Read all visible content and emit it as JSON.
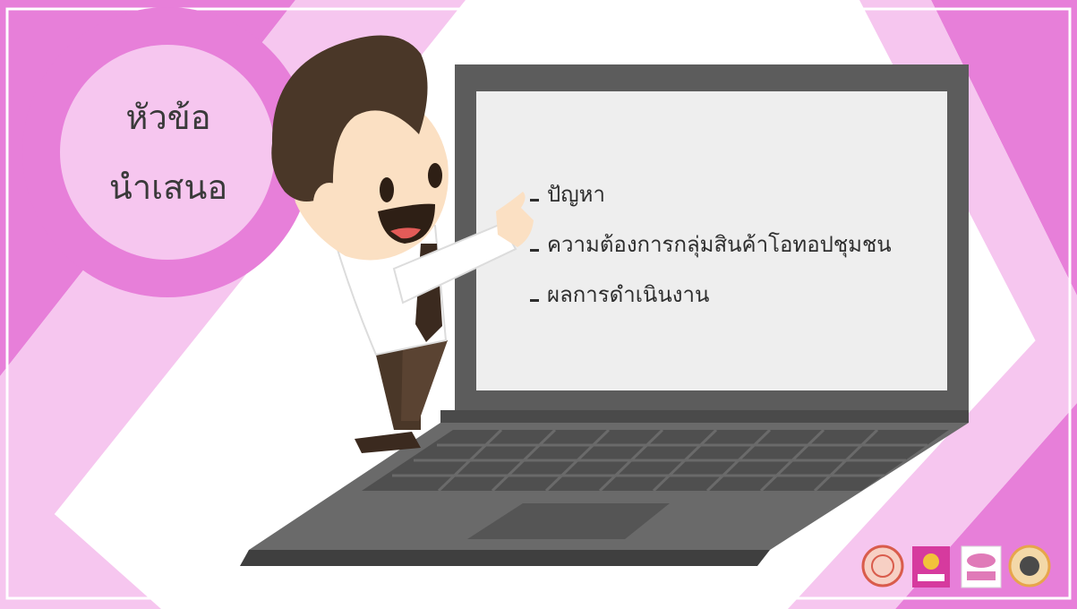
{
  "slide": {
    "title_lines": [
      "หัวข้อ",
      "นำเสนอ"
    ],
    "agenda_items": [
      "ปัญหา",
      "ความต้องการกลุ่มสินค้าโอทอปชุมชน",
      "ผลการดำเนินงาน"
    ],
    "logos": [
      "seal-logo",
      "ministry-logo",
      "otop-logo",
      "community-logo"
    ]
  },
  "colors": {
    "pink_dark": "#e77fd9",
    "pink_light": "#f6c6ef",
    "laptop_body": "#5c5c5c",
    "screen": "#eeeeee",
    "hair": "#4a3728",
    "skin": "#fbe0c3"
  }
}
